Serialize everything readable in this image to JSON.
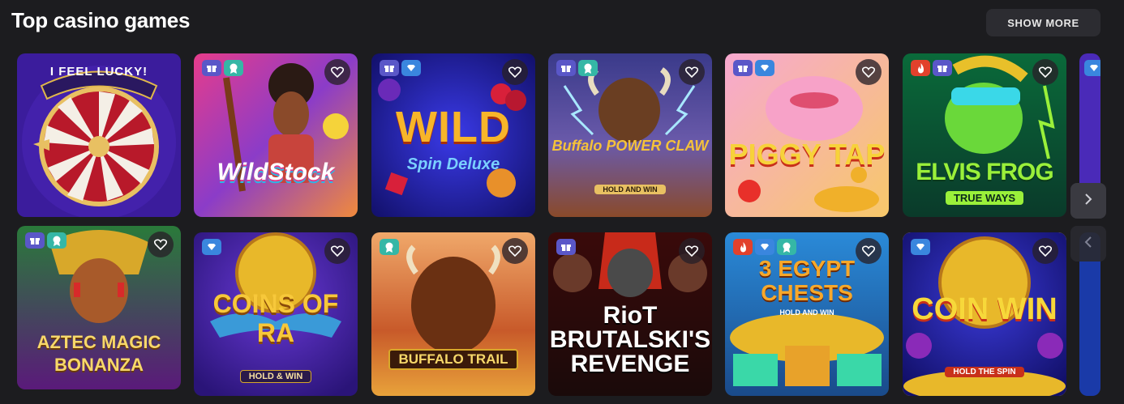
{
  "header": {
    "title": "Top casino games",
    "show_more_label": "SHOW MORE"
  },
  "games": [
    {
      "title": "I FEEL LUCKY!",
      "subtitle": ""
    },
    {
      "title": "WildStock",
      "subtitle": ""
    },
    {
      "title": "WILD",
      "subtitle": "Spin Deluxe"
    },
    {
      "title": "Buffalo POWER CLAW",
      "subtitle": "HOLD AND WIN"
    },
    {
      "title": "PIGGY TAP",
      "subtitle": ""
    },
    {
      "title": "ELVIS FROG",
      "subtitle": "TRUE WAYS"
    },
    {
      "title": "AZTEC MAGIC BONANZA",
      "subtitle": ""
    },
    {
      "title": "COINS OF RA",
      "subtitle": "HOLD & WIN"
    },
    {
      "title": "BUFFALO TRAIL",
      "subtitle": ""
    },
    {
      "title": "RioT BRUTALSKI'S REVENGE",
      "subtitle": ""
    },
    {
      "title": "3 EGYPT CHESTS",
      "subtitle": "HOLD AND WIN"
    },
    {
      "title": "COIN WIN",
      "subtitle": "HOLD THE SPIN"
    }
  ],
  "colors": {
    "background": "#1c1c1f",
    "gift_badge": "#5a57c8",
    "award_badge": "#35b7a6",
    "gem_badge": "#3a86de",
    "fire_badge": "#e2412c",
    "selected_outline": "#e8c04a"
  }
}
